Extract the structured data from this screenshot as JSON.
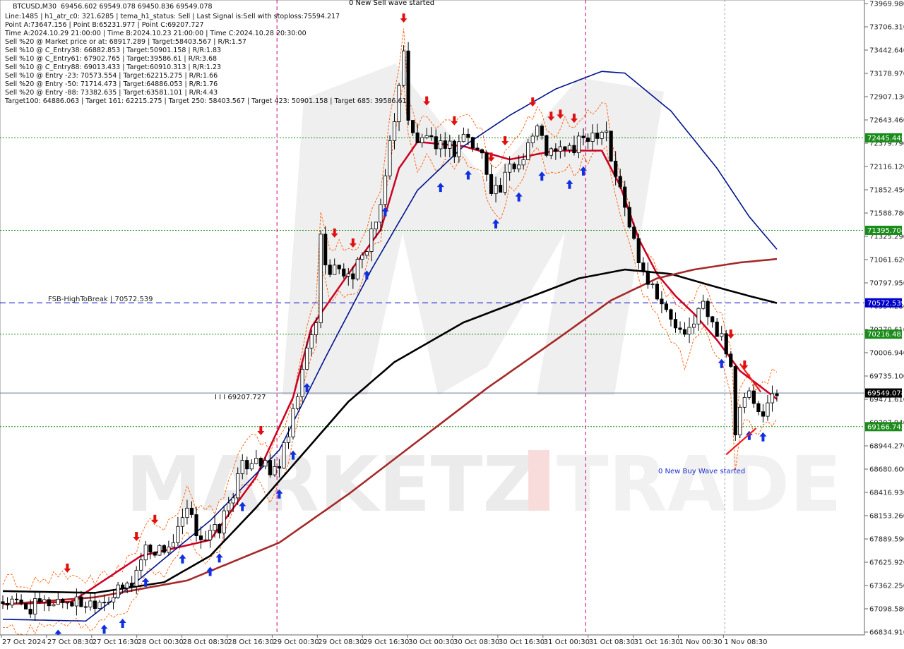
{
  "window": {
    "symbol": "BTCUSD,M30",
    "ohlc": "69456.602 69549.078 69450.836 69549.078"
  },
  "info_lines": [
    "Line:1485  |  h1_atr_c0: 321.6285  |  tema_h1_status: Sell  |  Last Signal is:Sell with stoploss:75594.217",
    "Point A:73647.156  |  Point B:65231.977  |  Point C:69207.727",
    "Time A:2024.10.29 21:00:00  |  Time B:2024.10.23 21:00:00  |  Time C:2024.10.28 20:30:00",
    "Sell %20 @ Market price or at: 68917.289  |  Target:58403.567  |  R/R:1.57",
    "Sell %10 @ C_Entry38: 66882.853  |  Target:50901.158  |  R/R:1.83",
    "Sell %10 @ C_Entry61: 67902.765  |  Target:39586.61  |  R/R:3.68",
    "Sell %10 @ C_Entry88: 69013.433  |  Target:60910.313  |  R/R:1.23",
    "Sell %10 @ Entry -23: 70573.554  |  Target:62215.275  |  R/R:1.66",
    "Sell %20 @ Entry -50: 71714.473  |  Target:64886.053  |  R/R:1.76",
    "Sell %20 @ Entry -88: 73382.635  |  Target:63581.101  |  R/R:4.43",
    "Target100: 64886.063  |  Target 161: 62215.275  |  Target 250: 58403.567  |  Target 423: 50901.158  |  Target 685: 39586.61"
  ],
  "watermark": {
    "left": "MARKETZ",
    "right": "TRADE"
  },
  "annotations": {
    "top_wave": "0 New Sell wave started",
    "buy_wave": "0 New Buy Wave started",
    "fsb": "FSB-HighToBreak  |  70572.539",
    "point_c": "I I I 69207.727"
  },
  "colors": {
    "bull": "#111111",
    "bear": "#111111",
    "red_ma": "#cc0022",
    "blue_ma": "#00148c",
    "black_ma": "#000000",
    "brown_ma": "#a52828",
    "level_green": "#1a8c1a",
    "level_blue": "#0000cc",
    "price_tag": "#000000",
    "orange_band": "#ff5a00",
    "arrow_up": "#1030e0",
    "arrow_down": "#e01010",
    "vline": "#cc0077"
  },
  "chart_data": {
    "type": "candlestick",
    "title": "BTCUSD,M30",
    "ylim": [
      66834.91,
      73969.98
    ],
    "y_ticks": [
      "73969.980",
      "73706.310",
      "73442.640",
      "73178.970",
      "72907.130",
      "72643.460",
      "72379.790",
      "72116.120",
      "71852.450",
      "71588.780",
      "71325.290",
      "71061.620",
      "70797.950",
      "70534.280",
      "70270.610",
      "70006.940",
      "69735.100",
      "69471.610",
      "69207.940",
      "68944.270",
      "68680.600",
      "68416.930",
      "68153.260",
      "67889.590",
      "67625.920",
      "67362.250",
      "67098.580",
      "66834.910"
    ],
    "x_ticks": [
      "27 Oct 2024",
      "27 Oct 08:30",
      "27 Oct 16:30",
      "28 Oct 00:30",
      "28 Oct 08:30",
      "28 Oct 16:30",
      "29 Oct 00:30",
      "29 Oct 08:30",
      "29 Oct 16:30",
      "30 Oct 00:30",
      "30 Oct 08:30",
      "30 Oct 16:30",
      "31 Oct 00:30",
      "31 Oct 08:30",
      "31 Oct 16:30",
      "1 Nov 00:30",
      "1 Nov 08:30"
    ],
    "levels": [
      {
        "price": 72445.445,
        "label": "72445.445",
        "color": "#1a8c1a",
        "style": "dotted"
      },
      {
        "price": 71395.704,
        "label": "71395.704",
        "color": "#1a8c1a",
        "style": "dotted"
      },
      {
        "price": 70572.539,
        "label": "70572.539",
        "color": "#0000cc",
        "style": "dashed"
      },
      {
        "price": 70216.483,
        "label": "70216.483",
        "color": "#1a8c1a",
        "style": "dotted"
      },
      {
        "price": 69166.742,
        "label": "69166.742",
        "color": "#1a8c1a",
        "style": "dotted"
      }
    ],
    "current_price": {
      "price": 69549.078,
      "label": "69549.078"
    },
    "close_path": [
      [
        0,
        67180
      ],
      [
        6,
        67110
      ],
      [
        12,
        67200
      ],
      [
        18,
        67160
      ],
      [
        24,
        67250
      ],
      [
        28,
        67400
      ],
      [
        31,
        67800
      ],
      [
        34,
        67760
      ],
      [
        37,
        67850
      ],
      [
        40,
        68200
      ],
      [
        42,
        67980
      ],
      [
        44,
        67900
      ],
      [
        47,
        68020
      ],
      [
        49,
        68300
      ],
      [
        52,
        68700
      ],
      [
        55,
        68850
      ],
      [
        58,
        68620
      ],
      [
        60,
        68750
      ],
      [
        62,
        69050
      ],
      [
        64,
        69520
      ],
      [
        66,
        70020
      ],
      [
        68,
        70380
      ],
      [
        69,
        71300
      ],
      [
        71,
        70880
      ],
      [
        73,
        71000
      ],
      [
        75,
        70850
      ],
      [
        78,
        71050
      ],
      [
        80,
        71400
      ],
      [
        82,
        71600
      ],
      [
        84,
        72400
      ],
      [
        86,
        73000
      ],
      [
        87,
        73400
      ],
      [
        88,
        72700
      ],
      [
        90,
        72350
      ],
      [
        92,
        72500
      ],
      [
        94,
        72250
      ],
      [
        96,
        72400
      ],
      [
        98,
        72300
      ],
      [
        100,
        72500
      ],
      [
        102,
        72350
      ],
      [
        104,
        72250
      ],
      [
        106,
        71900
      ],
      [
        108,
        71850
      ],
      [
        110,
        72100
      ],
      [
        112,
        72150
      ],
      [
        114,
        72400
      ],
      [
        116,
        72550
      ],
      [
        118,
        72300
      ],
      [
        120,
        72250
      ],
      [
        122,
        72350
      ],
      [
        124,
        72300
      ],
      [
        126,
        72450
      ],
      [
        128,
        72500
      ],
      [
        130,
        72550
      ],
      [
        131,
        72550
      ],
      [
        132,
        72200
      ],
      [
        134,
        71850
      ],
      [
        136,
        71450
      ],
      [
        138,
        71100
      ],
      [
        140,
        70850
      ],
      [
        142,
        70700
      ],
      [
        144,
        70450
      ],
      [
        146,
        70300
      ],
      [
        148,
        70150
      ],
      [
        150,
        70400
      ],
      [
        152,
        70550
      ],
      [
        154,
        70300
      ],
      [
        156,
        70250
      ],
      [
        158,
        69800
      ],
      [
        159,
        69000
      ],
      [
        160,
        69400
      ],
      [
        162,
        69500
      ],
      [
        164,
        69300
      ],
      [
        166,
        69450
      ],
      [
        168,
        69549
      ]
    ],
    "series": [
      {
        "name": "red_ma",
        "values": [
          [
            0,
            67150
          ],
          [
            15,
            67180
          ],
          [
            30,
            67700
          ],
          [
            45,
            67880
          ],
          [
            55,
            68600
          ],
          [
            63,
            69500
          ],
          [
            67,
            70300
          ],
          [
            75,
            70900
          ],
          [
            82,
            71400
          ],
          [
            86,
            72100
          ],
          [
            90,
            72400
          ],
          [
            100,
            72350
          ],
          [
            110,
            72200
          ],
          [
            120,
            72300
          ],
          [
            130,
            72300
          ],
          [
            134,
            71900
          ],
          [
            138,
            71300
          ],
          [
            142,
            70900
          ],
          [
            146,
            70650
          ],
          [
            150,
            70450
          ],
          [
            155,
            70150
          ],
          [
            160,
            69800
          ],
          [
            165,
            69600
          ],
          [
            168,
            69480
          ]
        ]
      },
      {
        "name": "blue_ma",
        "values": [
          [
            0,
            66980
          ],
          [
            18,
            66960
          ],
          [
            30,
            67450
          ],
          [
            45,
            68100
          ],
          [
            60,
            68900
          ],
          [
            70,
            69950
          ],
          [
            80,
            70950
          ],
          [
            90,
            71850
          ],
          [
            100,
            72350
          ],
          [
            110,
            72700
          ],
          [
            120,
            73000
          ],
          [
            130,
            73200
          ],
          [
            135,
            73180
          ],
          [
            145,
            72750
          ],
          [
            155,
            72100
          ],
          [
            162,
            71550
          ],
          [
            168,
            71180
          ]
        ]
      },
      {
        "name": "black_ma",
        "values": [
          [
            0,
            67300
          ],
          [
            20,
            67280
          ],
          [
            35,
            67400
          ],
          [
            45,
            67700
          ],
          [
            55,
            68250
          ],
          [
            65,
            68850
          ],
          [
            75,
            69450
          ],
          [
            85,
            69900
          ],
          [
            100,
            70350
          ],
          [
            115,
            70650
          ],
          [
            125,
            70850
          ],
          [
            135,
            70950
          ],
          [
            145,
            70900
          ],
          [
            155,
            70750
          ],
          [
            162,
            70650
          ],
          [
            168,
            70570
          ]
        ]
      },
      {
        "name": "brown_ma",
        "values": [
          [
            0,
            67150
          ],
          [
            20,
            67230
          ],
          [
            40,
            67420
          ],
          [
            60,
            67850
          ],
          [
            75,
            68400
          ],
          [
            90,
            69000
          ],
          [
            105,
            69600
          ],
          [
            120,
            70150
          ],
          [
            132,
            70600
          ],
          [
            142,
            70850
          ],
          [
            150,
            70950
          ],
          [
            160,
            71030
          ],
          [
            168,
            71070
          ]
        ]
      }
    ]
  }
}
